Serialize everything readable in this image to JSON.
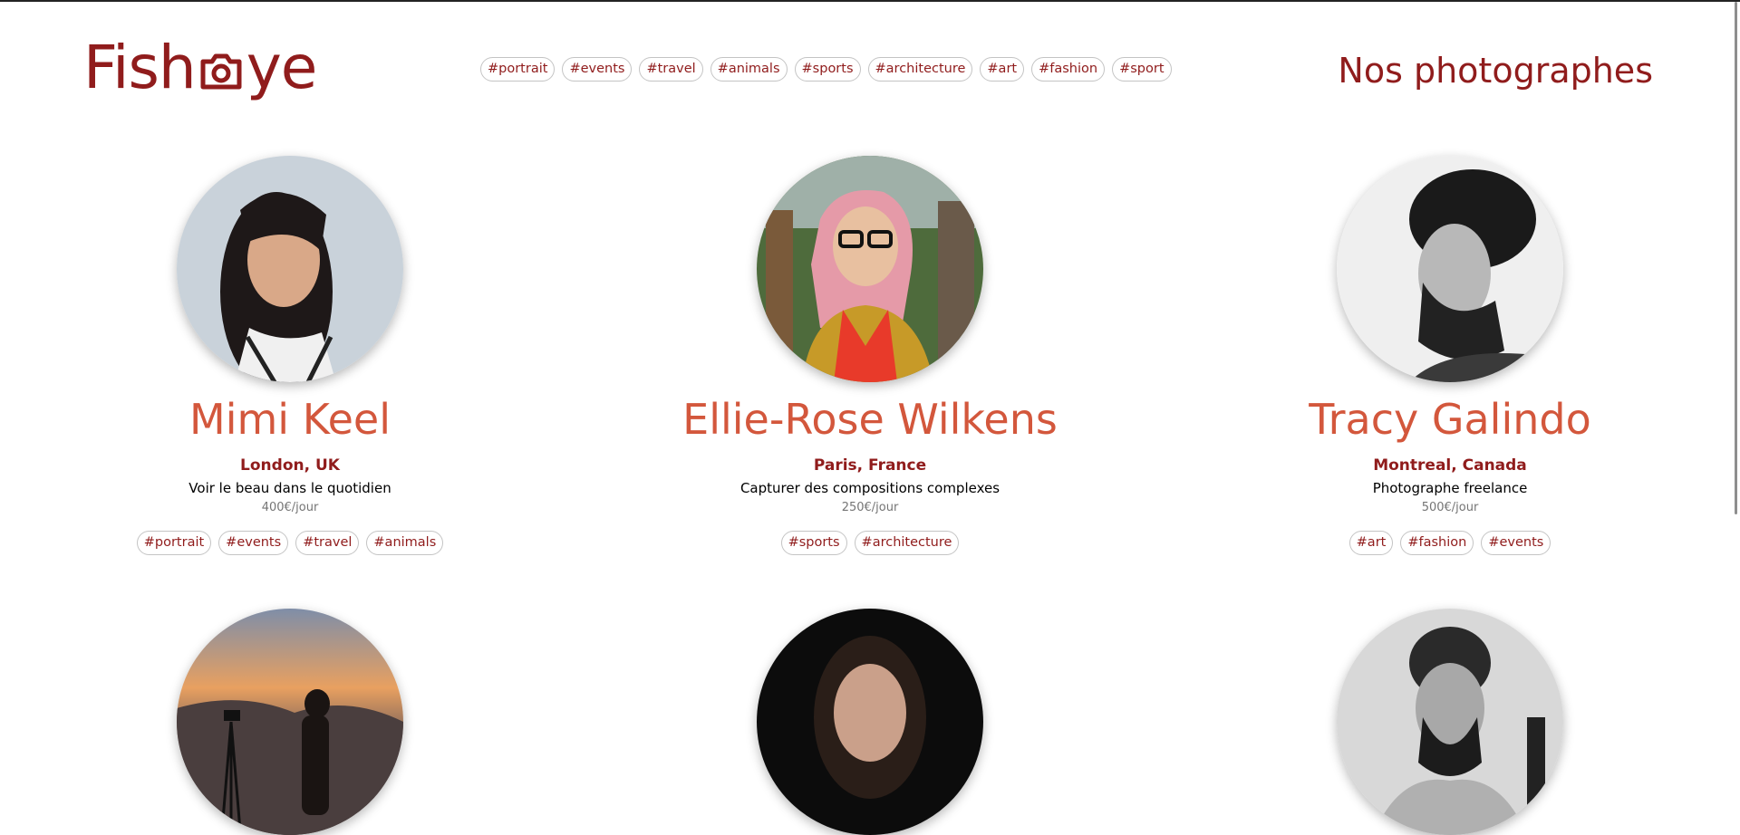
{
  "header": {
    "logo_text_left": "Fish",
    "logo_text_right": "ye",
    "logo_icon": "camera-icon",
    "title": "Nos photographes",
    "nav_tags": [
      "#portrait",
      "#events",
      "#travel",
      "#animals",
      "#sports",
      "#architecture",
      "#art",
      "#fashion",
      "#sport"
    ]
  },
  "photographers": [
    {
      "name": "Mimi Keel",
      "location": "London, UK",
      "tagline": "Voir le beau dans le quotidien",
      "price": "400€/jour",
      "tags": [
        "#portrait",
        "#events",
        "#travel",
        "#animals"
      ]
    },
    {
      "name": "Ellie-Rose Wilkens",
      "location": "Paris, France",
      "tagline": "Capturer des compositions complexes",
      "price": "250€/jour",
      "tags": [
        "#sports",
        "#architecture"
      ]
    },
    {
      "name": "Tracy Galindo",
      "location": "Montreal, Canada",
      "tagline": "Photographe freelance",
      "price": "500€/jour",
      "tags": [
        "#art",
        "#fashion",
        "#events"
      ]
    }
  ],
  "colors": {
    "brand": "#901c1c",
    "name_accent": "#d3573c",
    "price_gray": "#757575"
  }
}
